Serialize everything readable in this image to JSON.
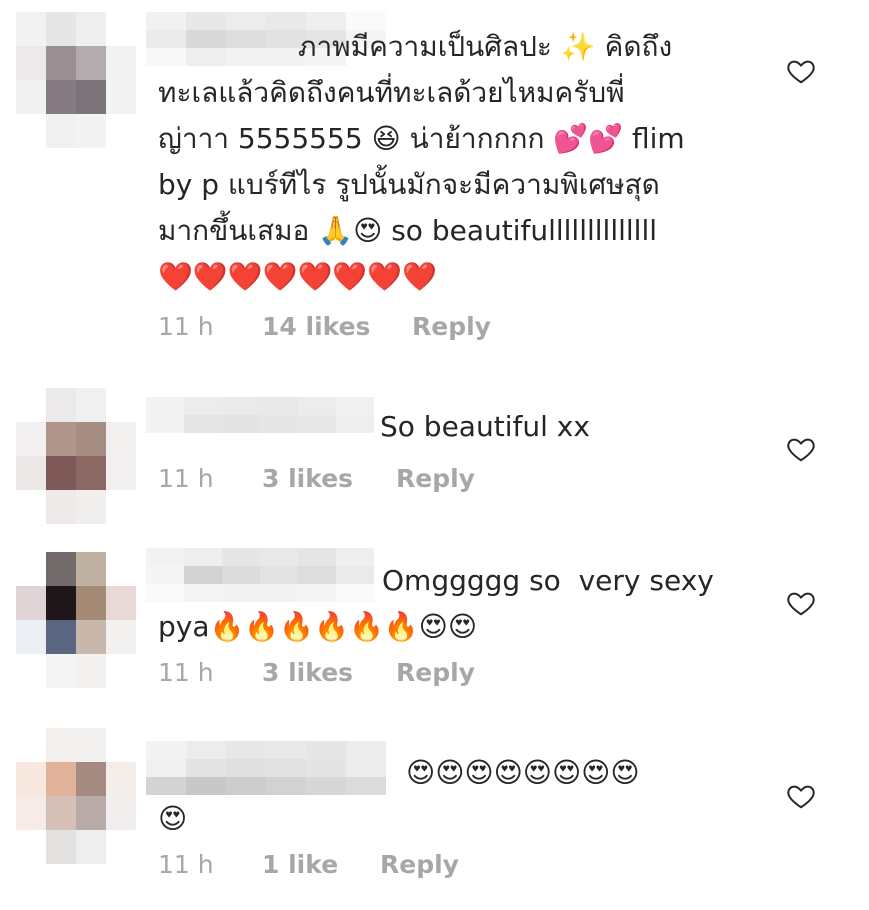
{
  "comments": [
    {
      "text": "ภาพมีความเป็นศิลปะ ✨ คิดถึง\nทะเลแล้วคิดถึงคนที่ทะเลด้วยไหมครับพี่\nญ่าาา 5555555 😆 น่าย้ากกกก 💕💕 flim\nby p แบร์ทีไร รูปนั้นมักจะมีความพิเศษสุด\nมากขึ้นเสมอ 🙏😍 so beautifullllllllllllll\n❤️❤️❤️❤️❤️❤️❤️❤️",
      "time": "11 h",
      "likes": "14 likes",
      "reply": "Reply",
      "like_icon": "heart-outline-icon"
    },
    {
      "text": "So beautiful xx",
      "time": "11 h",
      "likes": "3 likes",
      "reply": "Reply",
      "like_icon": "heart-outline-icon"
    },
    {
      "text": "Omggggg so  very sexy\npya🔥🔥🔥🔥🔥🔥😍😍",
      "time": "11 h",
      "likes": "3 likes",
      "reply": "Reply",
      "like_icon": "heart-outline-icon"
    },
    {
      "text": "😍😍😍😍😍😍😍😍\n😍",
      "time": "11 h",
      "likes": "1 like",
      "reply": "Reply",
      "like_icon": "heart-outline-icon"
    }
  ],
  "colors": {
    "text": "#262626",
    "meta": "#a7a7a7",
    "icon": "#262626"
  }
}
